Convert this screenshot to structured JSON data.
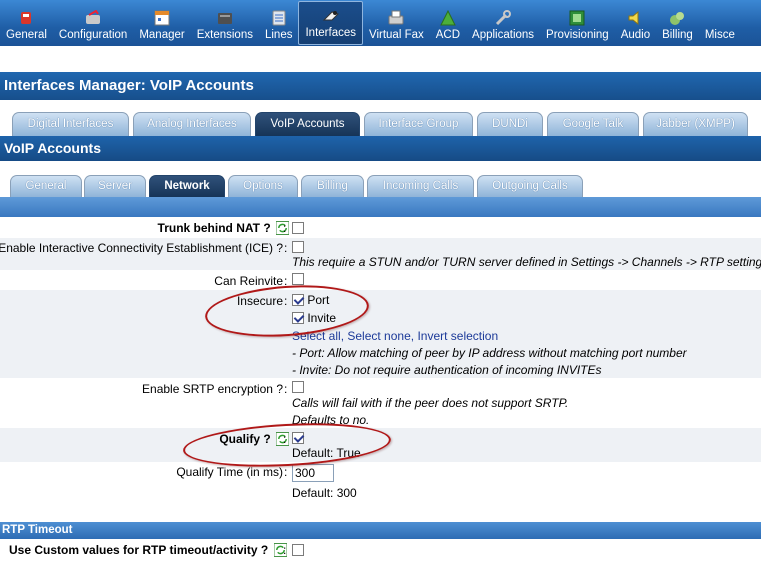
{
  "nav": [
    {
      "label": "General",
      "icon": "general-icon"
    },
    {
      "label": "Configuration",
      "icon": "configuration-icon"
    },
    {
      "label": "Manager",
      "icon": "manager-icon"
    },
    {
      "label": "Extensions",
      "icon": "extensions-icon"
    },
    {
      "label": "Lines",
      "icon": "lines-icon"
    },
    {
      "label": "Interfaces",
      "icon": "interfaces-icon"
    },
    {
      "label": "Virtual Fax",
      "icon": "fax-icon"
    },
    {
      "label": "ACD",
      "icon": "acd-icon"
    },
    {
      "label": "Applications",
      "icon": "applications-icon"
    },
    {
      "label": "Provisioning",
      "icon": "provisioning-icon"
    },
    {
      "label": "Audio",
      "icon": "audio-icon"
    },
    {
      "label": "Billing",
      "icon": "billing-icon"
    },
    {
      "label": "Misce",
      "icon": "misc-icon"
    }
  ],
  "page_title": "Interfaces Manager:  VoIP Accounts",
  "tabs": [
    "Digital Interfaces",
    "Analog Interfaces",
    "VoIP Accounts",
    "Interface Group",
    "DUNDi",
    "Google Talk",
    "Jabber (XMPP)"
  ],
  "section_title": "VoIP Accounts",
  "subtabs": [
    "General",
    "Server",
    "Network",
    "Options",
    "Billing",
    "Incoming Calls",
    "Outgoing Calls"
  ],
  "form": {
    "trunk_nat": {
      "label": "Trunk behind NAT ?",
      "checked": false
    },
    "ice": {
      "label": "Enable Interactive Connectivity Establishment (ICE) ?",
      "checked": false,
      "hint": "This require a STUN and/or TURN server defined in Settings -> Channels -> RTP settings."
    },
    "reinvite": {
      "label": "Can Reinvite",
      "checked": false
    },
    "insecure": {
      "label": "Insecure",
      "opt_port": "Port",
      "opt_invite": "Invite",
      "select_all": "Select all",
      "select_none": "Select none",
      "invert": "Invert selection",
      "sep1": ", ",
      "sep2": ", ",
      "note_port": "- Port: Allow matching of peer by IP address without matching port number",
      "note_invite": "- Invite: Do not require authentication of incoming INVITEs"
    },
    "srtp": {
      "label": "Enable SRTP encryption ?",
      "hint1": "Calls will fail with if the peer does not support SRTP.",
      "hint2": "Defaults to no."
    },
    "qualify": {
      "label": "Qualify ?",
      "default": "Default: True"
    },
    "qualify_time": {
      "label": "Qualify Time (in ms)",
      "value": "300",
      "default": "Default: 300"
    }
  },
  "rtp_section": "RTP Timeout",
  "rtp_custom": {
    "label": "Use Custom values for RTP timeout/activity ?"
  },
  "colon": ":"
}
